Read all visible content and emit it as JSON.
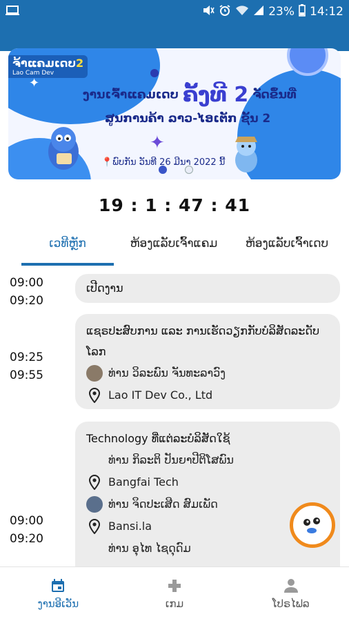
{
  "status_bar": {
    "battery_pct": "23%",
    "time": "14:12",
    "icons": [
      "screen-icon",
      "mute-icon",
      "alarm-icon",
      "wifi-icon",
      "signal-icon",
      "battery-icon"
    ]
  },
  "banner": {
    "logo_text": "ຈ້າແຄມເດບ",
    "logo_num": "2",
    "logo_sub": "Lao Cam Dev",
    "line1_a": "ງານເຈົ້າແຄມເດບ",
    "line1_big": "ຄັ້ງທີ 2",
    "line1_b": "ຈັດຂຶ້ນທີ່",
    "line2": "ສູນການຄ້າ ລາວ-ໄອເຕັກ ຊັ້ນ 2",
    "line3": "📍ພົບກັນ ວັນທີ 26 ມີນາ 2022 ນີ້"
  },
  "countdown": "19 : 1 : 47 : 41",
  "tabs": [
    {
      "label": "ເວທີຫຼັກ",
      "active": true
    },
    {
      "label": "ຫ້ອງແລັບເຈົ້າແຄມ",
      "active": false
    },
    {
      "label": "ຫ້ອງແລັບເຈົ້າເດບ",
      "active": false
    }
  ],
  "schedule": [
    {
      "start": "09:00",
      "end": "09:20",
      "title": "ເປີດງານ"
    },
    {
      "start": "09:25",
      "end": "09:55",
      "title": "ແຊຣປະສົບການ ແລະ ການເຮັດວຽກກັບບໍລິສັດລະດັບໂລກ",
      "speaker": "ທ່ານ ວິລະພົນ ຈັນທະລາວົງ",
      "company": "Lao IT Dev Co., Ltd"
    },
    {
      "start": "09:00",
      "end": "09:20",
      "title": "Technology ທີ່ແຕ່ລະບໍລິສັດໃຊ້",
      "speaker1": "ທ່ານ ກິລະຕິ ປັນຍາປີຕິໂສພົນ",
      "company1": "Bangfai Tech",
      "speaker2": "ທ່ານ ຈິດປະເສີດ ສົມເພັດ",
      "company2": "Bansi.la",
      "speaker3": "ທ່ານ ອຸໄທ ໄຊດຸດົມ"
    }
  ],
  "bottom_nav": [
    {
      "label": "ງານອີເວັນ",
      "icon": "calendar-icon",
      "active": true
    },
    {
      "label": "ເກມ",
      "icon": "gamepad-icon",
      "active": false
    },
    {
      "label": "ໂປຣໄຟລ",
      "icon": "person-icon",
      "active": false
    }
  ],
  "colors": {
    "primary": "#1d6fb0",
    "card": "#ececec",
    "accent": "#f08a1c"
  }
}
